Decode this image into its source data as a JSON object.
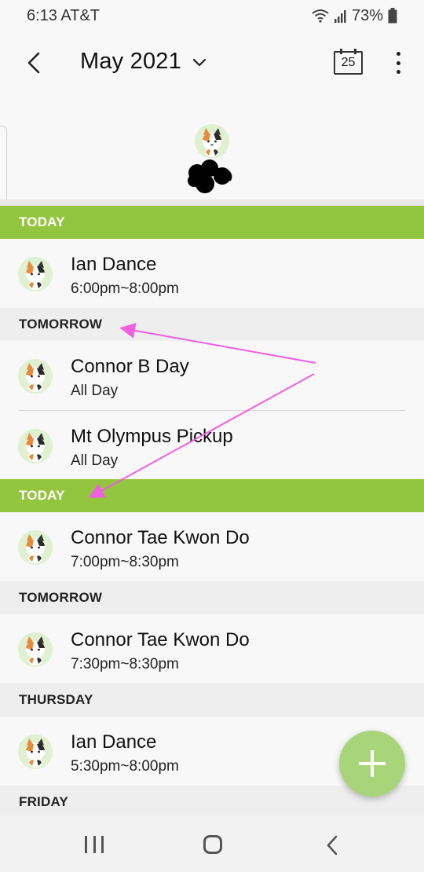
{
  "status_bar": {
    "time_carrier": "6:13 AT&T",
    "battery": "73%"
  },
  "header": {
    "title": "May 2021",
    "today_date": "25"
  },
  "sections": [
    {
      "label": "TODAY",
      "style": "today",
      "events": [
        {
          "title": "Ian Dance",
          "time": "6:00pm~8:00pm"
        }
      ]
    },
    {
      "label": "TOMORROW",
      "style": "other",
      "events": [
        {
          "title": "Connor B Day",
          "time": "All Day"
        },
        {
          "title": "Mt Olympus Pickup",
          "time": "All Day"
        }
      ]
    },
    {
      "label": "TODAY",
      "style": "today",
      "events": [
        {
          "title": "Connor Tae Kwon Do",
          "time": "7:00pm~8:30pm"
        }
      ]
    },
    {
      "label": "TOMORROW",
      "style": "other",
      "events": [
        {
          "title": "Connor Tae Kwon Do",
          "time": "7:30pm~8:30pm"
        }
      ]
    },
    {
      "label": "THURSDAY",
      "style": "other",
      "events": [
        {
          "title": "Ian Dance",
          "time": "5:30pm~8:00pm"
        }
      ]
    },
    {
      "label": "FRIDAY",
      "style": "other",
      "events": []
    }
  ],
  "icons": {
    "back": "arrow-back-icon",
    "dropdown": "chevron-down-icon",
    "today": "calendar-today-icon",
    "more": "more-vert-icon",
    "avatar": "calico-cat-avatar-icon",
    "add": "plus-icon"
  },
  "colors": {
    "today_header": "#93c53f",
    "other_header": "#eeeeee",
    "fab": "#a9d57a",
    "annotation_arrow": "#f060e0"
  }
}
